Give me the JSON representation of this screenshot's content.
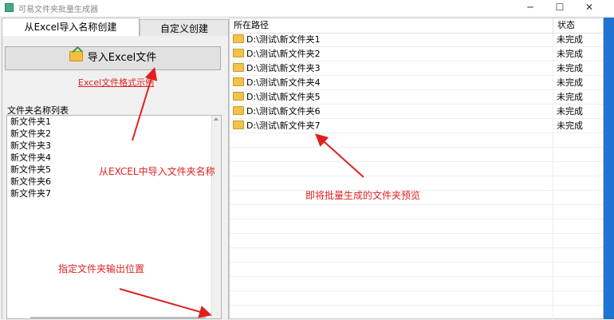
{
  "window": {
    "title": "可易文件夹批量生成器",
    "min_icon": "minimize-icon",
    "max_icon": "maximize-icon",
    "close_icon": "close-icon"
  },
  "tabs": [
    {
      "label": "从Excel导入名称创建",
      "active": true
    },
    {
      "label": "自定义创建",
      "active": false
    }
  ],
  "left": {
    "import_button_label": "导入Excel文件",
    "example_link": "Excel文件格式示例",
    "list_label": "文件夹名称列表",
    "names": [
      "新文件夹1",
      "新文件夹2",
      "新文件夹3",
      "新文件夹4",
      "新文件夹5",
      "新文件夹6",
      "新文件夹7"
    ]
  },
  "table": {
    "headers": {
      "path": "所在路径",
      "status": "状态"
    },
    "rows": [
      {
        "path": "D:\\测试\\新文件夹1",
        "status": "未完成"
      },
      {
        "path": "D:\\测试\\新文件夹2",
        "status": "未完成"
      },
      {
        "path": "D:\\测试\\新文件夹3",
        "status": "未完成"
      },
      {
        "path": "D:\\测试\\新文件夹4",
        "status": "未完成"
      },
      {
        "path": "D:\\测试\\新文件夹5",
        "status": "未完成"
      },
      {
        "path": "D:\\测试\\新文件夹6",
        "status": "未完成"
      },
      {
        "path": "D:\\测试\\新文件夹7",
        "status": "未完成"
      }
    ]
  },
  "annotations": {
    "import_note": "从EXCEL中导入文件夹名称",
    "preview_note": "即将批量生成的文件夹预览",
    "output_note": "指定文件夹输出位置"
  },
  "colors": {
    "annotation": "#e02020",
    "folder": "#f2c24a",
    "accent_strip": "#1e74d0"
  }
}
